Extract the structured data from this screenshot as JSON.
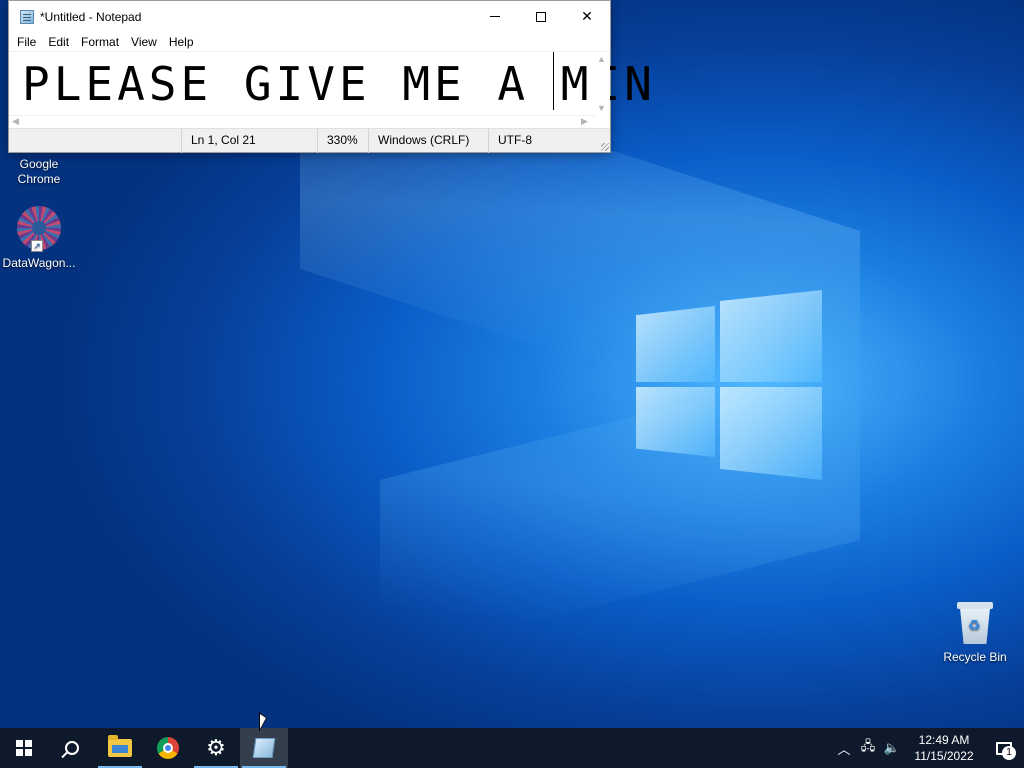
{
  "notepad": {
    "title": "*Untitled - Notepad",
    "menu": [
      "File",
      "Edit",
      "Format",
      "View",
      "Help"
    ],
    "content": "PLEASE GIVE ME A MIN",
    "status": {
      "position": "Ln 1, Col 21",
      "zoom": "330%",
      "line_ending": "Windows (CRLF)",
      "encoding": "UTF-8"
    }
  },
  "desktop": {
    "icons": [
      {
        "label": "Google\nChrome",
        "icon": "chrome-icon"
      },
      {
        "label": "DataWagon...",
        "icon": "datawagon-icon"
      },
      {
        "label": "Recycle Bin",
        "icon": "recycle-bin-icon"
      }
    ]
  },
  "taskbar": {
    "pinned": [
      "start",
      "search",
      "file-explorer",
      "google-chrome",
      "settings",
      "notepad"
    ],
    "active": "notepad",
    "clock": {
      "time": "12:49 AM",
      "date": "11/15/2022"
    },
    "notifications": "1"
  },
  "colors": {
    "taskbar": "#0e1a2b",
    "accent": "#76b9ed",
    "desktop": "#0a5cc6"
  }
}
